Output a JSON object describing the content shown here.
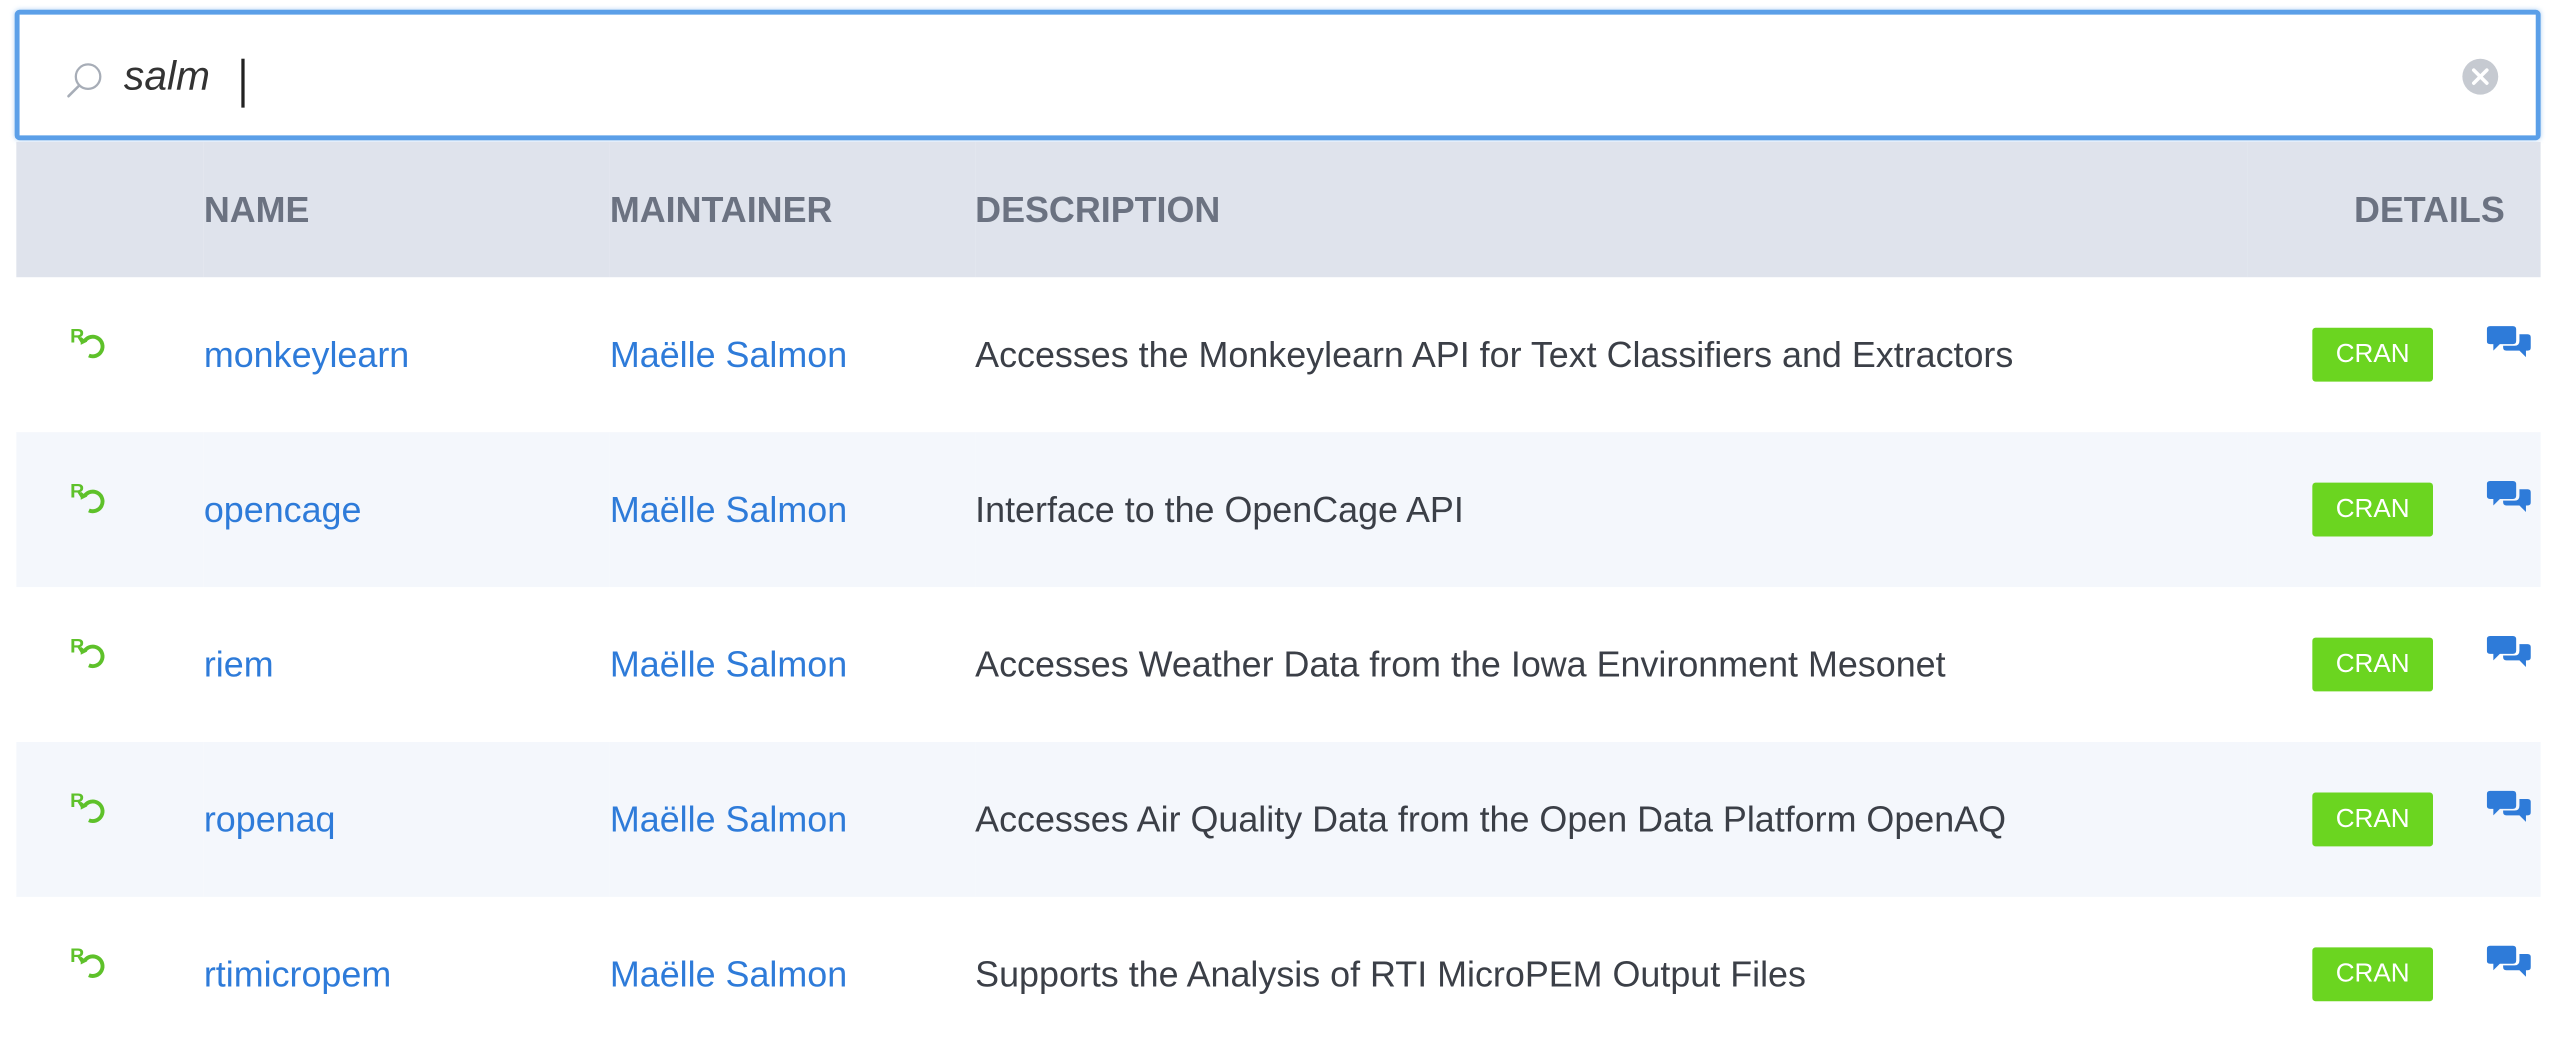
{
  "search": {
    "query": "salm",
    "icon": "search-icon",
    "clear_icon": "clear-icon"
  },
  "table": {
    "headers": {
      "name": "NAME",
      "maintainer": "MAINTAINER",
      "description": "DESCRIPTION",
      "details": "DETAILS"
    },
    "rows": [
      {
        "name": "monkeylearn",
        "maintainer": "Maëlle Salmon",
        "description": "Accesses the Monkeylearn API for Text Classifiers and Extractors",
        "badge": "CRAN"
      },
      {
        "name": "opencage",
        "maintainer": "Maëlle Salmon",
        "description": "Interface to the OpenCage API",
        "badge": "CRAN"
      },
      {
        "name": "riem",
        "maintainer": "Maëlle Salmon",
        "description": "Accesses Weather Data from the Iowa Environment Mesonet",
        "badge": "CRAN"
      },
      {
        "name": "ropenaq",
        "maintainer": "Maëlle Salmon",
        "description": "Accesses Air Quality Data from the Open Data Platform OpenAQ",
        "badge": "CRAN"
      },
      {
        "name": "rtimicropem",
        "maintainer": "Maëlle Salmon",
        "description": "Supports the Analysis of RTI MicroPEM Output Files",
        "badge": "CRAN"
      }
    ]
  },
  "colors": {
    "link": "#2e7bd9",
    "badge": "#6bd520",
    "header_bg": "#dfe3ec",
    "row_alt_bg": "#f4f7fc",
    "focus_border": "#5b9fe8"
  }
}
